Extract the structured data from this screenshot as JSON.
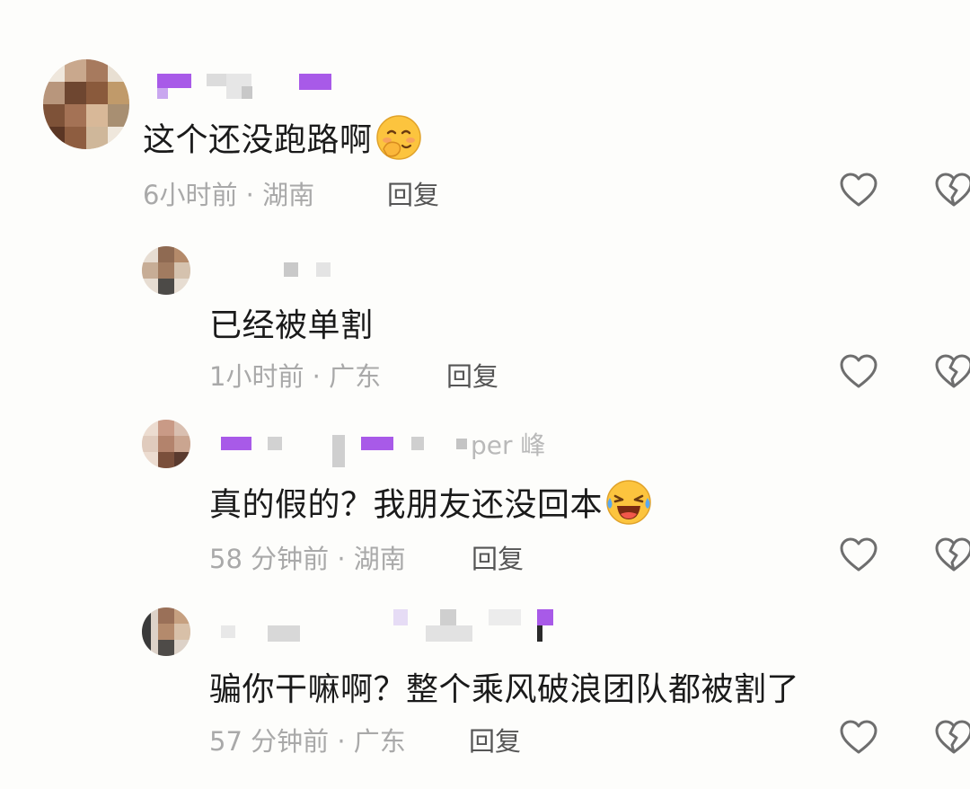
{
  "comments": [
    {
      "level": "top",
      "text": "这个还没跑路啊",
      "emoji": "shy-smile-emoji",
      "time": "6小时前",
      "separator": "·",
      "location": "湖南",
      "reply_label": "回复"
    },
    {
      "level": "reply",
      "text": "已经被单割",
      "time": "1小时前",
      "separator": "·",
      "location": "广东",
      "reply_label": "回复"
    },
    {
      "level": "reply",
      "name_suffix": "per 峰",
      "text": "真的假的？我朋友还没回本",
      "emoji": "crying-laughing-emoji",
      "time": "58 分钟前",
      "separator": "·",
      "location": "湖南",
      "reply_label": "回复"
    },
    {
      "level": "reply",
      "text": "骗你干嘛啊？整个乘风破浪团队都被割了",
      "time": "57 分钟前",
      "separator": "·",
      "location": "广东",
      "reply_label": "回复"
    }
  ],
  "icons": {
    "like": "heart-outline-icon",
    "dislike": "broken-heart-icon"
  },
  "colors": {
    "name_purple": "#a85ae8",
    "meta_gray": "#a9a9a9",
    "text": "#1a1a1a"
  }
}
